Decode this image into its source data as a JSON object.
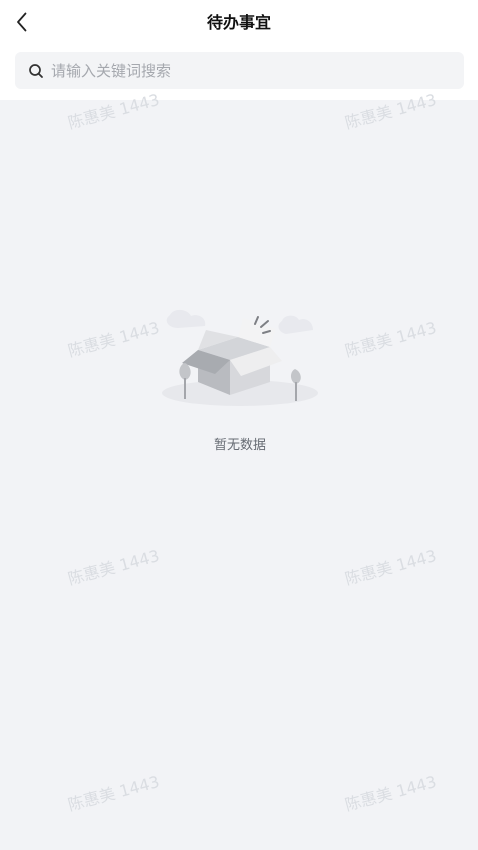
{
  "header": {
    "title": "待办事宜",
    "back_icon": "chevron-left-icon"
  },
  "search": {
    "icon": "search-icon",
    "placeholder": "请输入关键词搜索"
  },
  "empty_state": {
    "illustration": "empty-box-icon",
    "text": "暂无数据"
  },
  "watermark": {
    "text": "陈惠美 1443"
  },
  "colors": {
    "background": "#f2f3f6",
    "header_background": "#ffffff",
    "search_background": "#f3f4f6",
    "placeholder": "#a5a8ae",
    "title": "#111111",
    "empty_text": "#666b73",
    "watermark": "#dadde2"
  }
}
